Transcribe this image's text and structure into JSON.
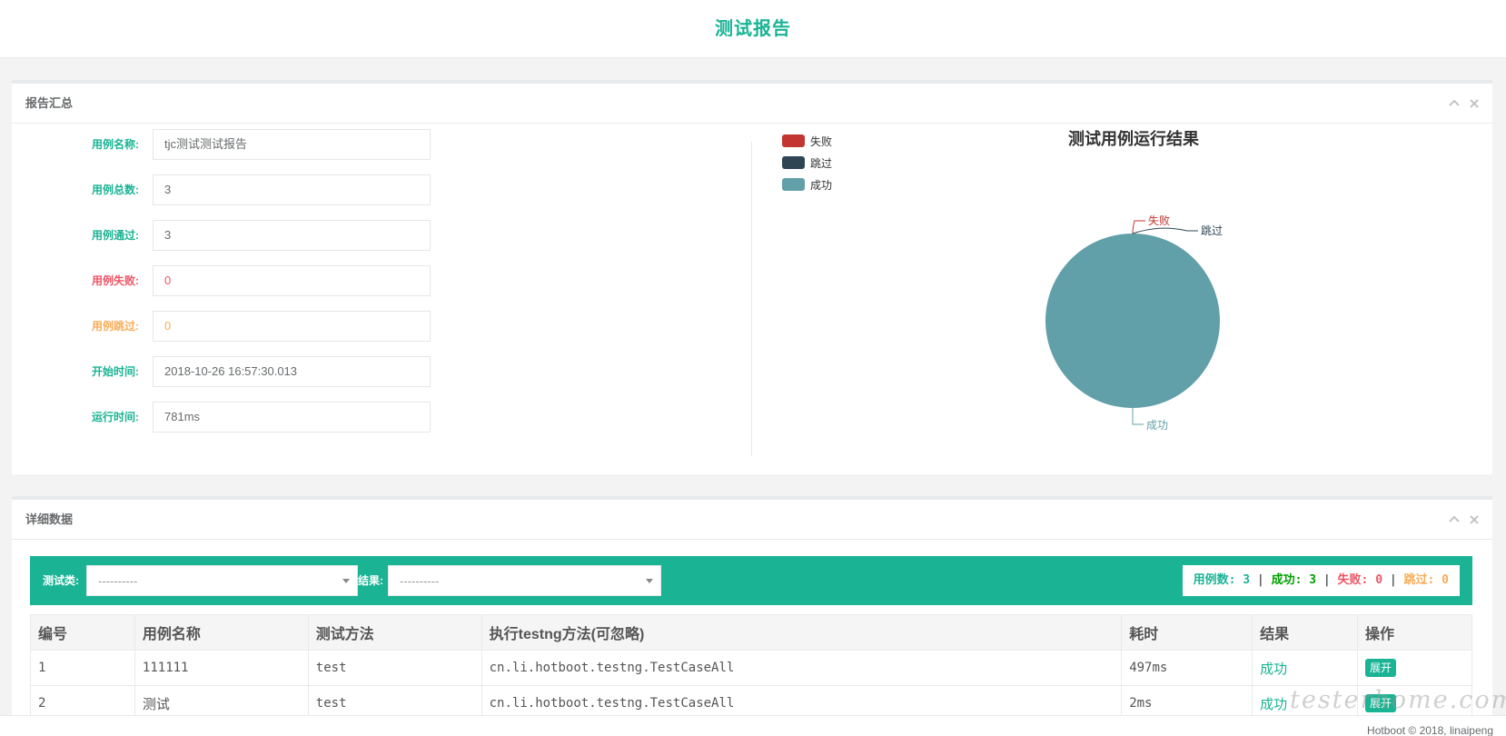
{
  "header": {
    "title": "测试报告"
  },
  "summary": {
    "title": "报告汇总",
    "fields": [
      {
        "label": "用例名称:",
        "value": "tjc测试测试报告",
        "style": "normal"
      },
      {
        "label": "用例总数:",
        "value": "3",
        "style": "normal"
      },
      {
        "label": "用例通过:",
        "value": "3",
        "style": "normal"
      },
      {
        "label": "用例失败:",
        "value": "0",
        "style": "fail"
      },
      {
        "label": "用例跳过:",
        "value": "0",
        "style": "skip"
      },
      {
        "label": "开始时间:",
        "value": "2018-10-26 16:57:30.013",
        "style": "normal"
      },
      {
        "label": "运行时间:",
        "value": "781ms",
        "style": "normal"
      }
    ]
  },
  "chart_data": {
    "type": "pie",
    "title": "测试用例运行结果",
    "legend_position": "top-left",
    "categories": [
      "失败",
      "跳过",
      "成功"
    ],
    "values": [
      0,
      0,
      3
    ],
    "colors": [
      "#c23531",
      "#2f4554",
      "#61a0a8"
    ]
  },
  "detail": {
    "title": "详细数据",
    "filter_class_label": "测试类:",
    "filter_class_value": "----------",
    "filter_result_label": "结果:",
    "filter_result_value": "----------",
    "counts": {
      "total_label": "用例数:",
      "total": "3",
      "success_label": "成功:",
      "success": "3",
      "fail_label": "失败:",
      "fail": "0",
      "skip_label": "跳过:",
      "skip": "0",
      "sep": "|"
    },
    "columns": [
      "编号",
      "用例名称",
      "测试方法",
      "执行testng方法(可忽略)",
      "耗时",
      "结果",
      "操作"
    ],
    "rows": [
      {
        "id": "1",
        "name": "111111",
        "method": "test",
        "testng": "cn.li.hotboot.testng.TestCaseAll",
        "time": "497ms",
        "result": "成功",
        "action": "展开"
      },
      {
        "id": "2",
        "name": "测试",
        "method": "test",
        "testng": "cn.li.hotboot.testng.TestCaseAll",
        "time": "2ms",
        "result": "成功",
        "action": "展开"
      }
    ]
  },
  "footer": {
    "text": "Hotboot © 2018, linaipeng"
  },
  "watermark": {
    "text": "testerhome.com"
  },
  "icons": {
    "collapse": "chevron-up-icon",
    "close": "close-icon"
  }
}
